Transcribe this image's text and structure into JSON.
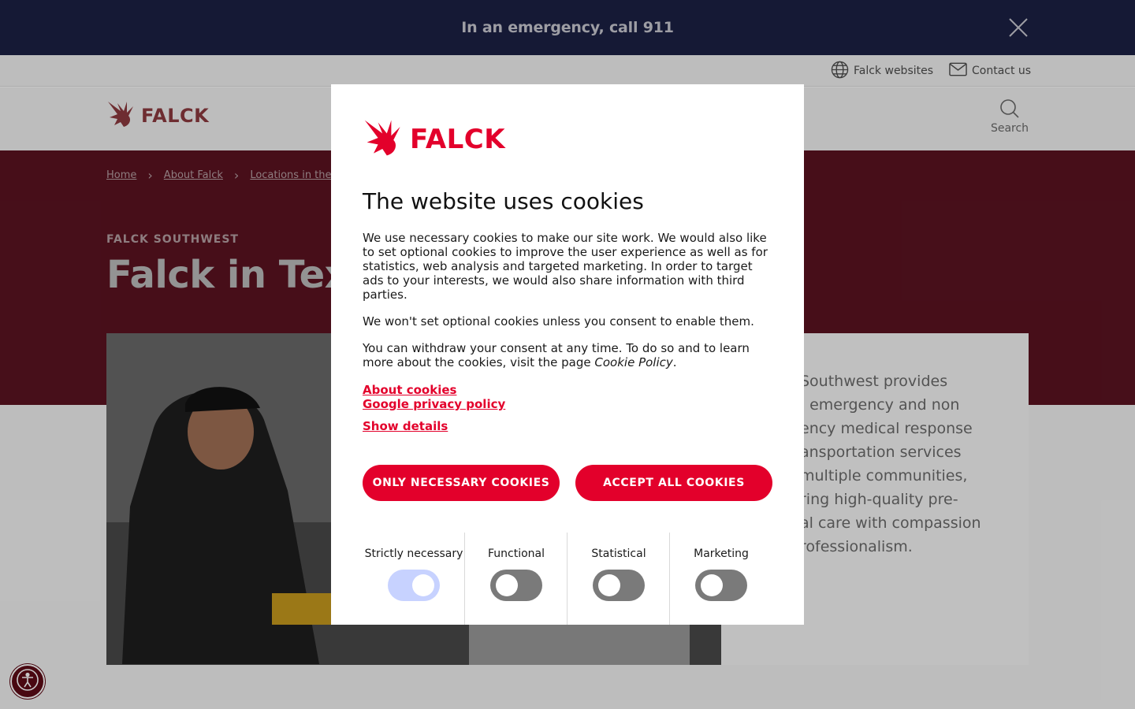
{
  "emergency_bar": {
    "message": "In an emergency, call 911"
  },
  "utility_nav": {
    "websites_label": "Falck websites",
    "contact_label": "Contact us"
  },
  "header": {
    "logo_text": "FALCK",
    "search_label": "Search"
  },
  "breadcrumb": {
    "items": [
      "Home",
      "About Falck",
      "Locations in the US"
    ]
  },
  "hero": {
    "eyebrow": "FALCK SOUTHWEST",
    "title": "Falck in Texa"
  },
  "intro_card": {
    "text": "Southwest provides\n, emergency and non\nency medical response\nansportation services\n multiple communities,\nring high-quality pre-\nal care with compassion\nrofessionalism."
  },
  "cookie_modal": {
    "logo_text": "FALCK",
    "title": "The website uses cookies",
    "paragraph_1": "We use necessary cookies to make our site work. We would also like to set optional cookies to improve the user experience as well as for statistics, web analysis and targeted marketing. In order to target ads to your interests, we would also share information with third parties.",
    "paragraph_2": "We won't set optional cookies unless you consent to enable them.",
    "paragraph_3_prefix": "You can withdraw your consent at any time. To do so and to learn more about the cookies, visit the page ",
    "paragraph_3_link": "Cookie Policy",
    "paragraph_3_suffix": ".",
    "links": {
      "about": "About cookies",
      "google": "Google privacy policy",
      "details": "Show details"
    },
    "buttons": {
      "necessary": "ONLY NECESSARY COOKIES",
      "accept_all": "ACCEPT ALL COOKIES"
    },
    "categories": [
      {
        "label": "Strictly necessary",
        "enabled": true
      },
      {
        "label": "Functional",
        "enabled": false
      },
      {
        "label": "Statistical",
        "enabled": false
      },
      {
        "label": "Marketing",
        "enabled": false
      }
    ]
  },
  "colors": {
    "brand_red": "#e3002b",
    "emergency_navy": "#1b2144",
    "hero_maroon": "#5b1321",
    "toggle_on": "#c7d2ff",
    "toggle_off": "#7a7a7a"
  }
}
